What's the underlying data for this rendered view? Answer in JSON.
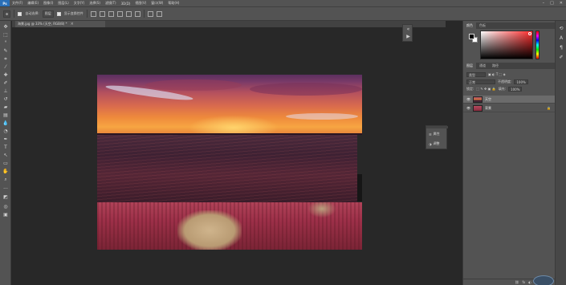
{
  "menubar": {
    "logo": "Ps",
    "items": [
      "文件(F)",
      "编辑(E)",
      "图像(I)",
      "图层(L)",
      "文字(Y)",
      "选择(S)",
      "滤镜(T)",
      "3D(D)",
      "视图(V)",
      "窗口(W)",
      "帮助(H)"
    ],
    "window_controls": [
      "–",
      "□",
      "✕"
    ]
  },
  "options": {
    "auto_select_label": "自动选择:",
    "auto_select_target": "图层",
    "show_transform_label": "显示变换控件"
  },
  "document": {
    "tab_title": "海景.jpg @ 33% (天空, RGB/8) *",
    "close_glyph": "×"
  },
  "floating_panel": {
    "row1_label": "属性",
    "row2_label": "调整"
  },
  "color_panel": {
    "tabs": [
      "颜色",
      "色板"
    ],
    "foreground": "#000000",
    "background": "#ffffff",
    "picker_hue": "#ff2a2a"
  },
  "layers_panel": {
    "tabs": [
      "图层",
      "通道",
      "路径"
    ],
    "kind_label": "类型",
    "blend_mode": "正常",
    "opacity_label": "不透明度:",
    "opacity_value": "100%",
    "lock_label": "锁定:",
    "fill_label": "填充:",
    "fill_value": "100%",
    "layers": [
      {
        "name": "天空",
        "selected": true
      },
      {
        "name": "背景",
        "selected": false
      }
    ],
    "footer_icons": [
      "fx",
      "◐",
      "▣",
      "+",
      "🗑"
    ]
  }
}
